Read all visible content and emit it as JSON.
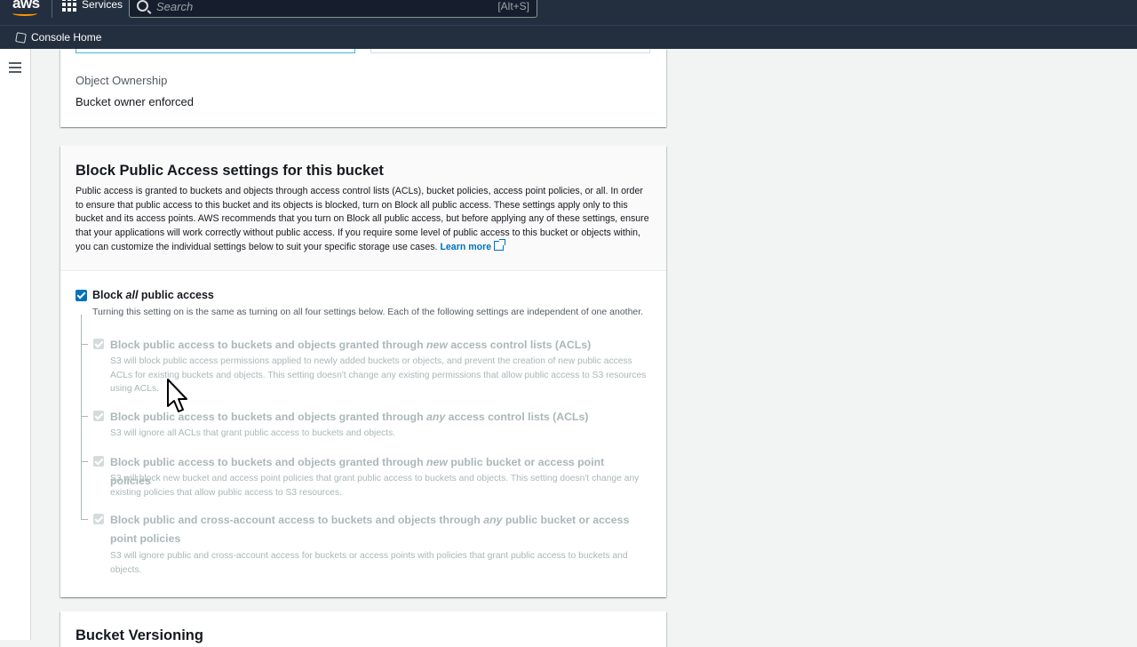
{
  "topnav": {
    "logo_text": "aws",
    "services_label": "Services",
    "search_placeholder": "Search",
    "search_shortcut": "[Alt+S]"
  },
  "subnav": {
    "console_home": "Console Home"
  },
  "ownership": {
    "label": "Object Ownership",
    "value": "Bucket owner enforced"
  },
  "block_public_access": {
    "title": "Block Public Access settings for this bucket",
    "description": "Public access is granted to buckets and objects through access control lists (ACLs), bucket policies, access point policies, or all. In order to ensure that public access to this bucket and its objects is blocked, turn on Block all public access. These settings apply only to this bucket and its access points. AWS recommends that you turn on Block all public access, but before applying any of these settings, ensure that your applications will work correctly without public access. If you require some level of public access to this bucket or objects within, you can customize the individual settings below to suit your specific storage use cases.",
    "learn_more": "Learn more",
    "main_checkbox": {
      "label_prefix": "Block ",
      "label_em": "all",
      "label_suffix": " public access",
      "checked": true,
      "description": "Turning this setting on is the same as turning on all four settings below. Each of the following settings are independent of one another."
    },
    "settings": [
      {
        "title_prefix": "Block public access to buckets and objects granted through ",
        "title_em": "new",
        "title_suffix": " access control lists (ACLs)",
        "description": "S3 will block public access permissions applied to newly added buckets or objects, and prevent the creation of new public access ACLs for existing buckets and objects. This setting doesn't change any existing permissions that allow public access to S3 resources using ACLs.",
        "checked": true
      },
      {
        "title_prefix": "Block public access to buckets and objects granted through ",
        "title_em": "any",
        "title_suffix": " access control lists (ACLs)",
        "description": "S3 will ignore all ACLs that grant public access to buckets and objects.",
        "checked": true
      },
      {
        "title_prefix": "Block public access to buckets and objects granted through ",
        "title_em": "new",
        "title_suffix": " public bucket or access point policies",
        "description": "S3 will block new bucket and access point policies that grant public access to buckets and objects. This setting doesn't change any existing policies that allow public access to S3 resources.",
        "checked": true
      },
      {
        "title_prefix": "Block public and cross-account access to buckets and objects through ",
        "title_em": "any",
        "title_suffix": " public bucket or access point policies",
        "description": "S3 will ignore public and cross-account access for buckets or access points with policies that grant public access to buckets and objects.",
        "checked": true
      }
    ]
  },
  "versioning": {
    "title": "Bucket Versioning"
  },
  "colors": {
    "nav_bg": "#232f3e",
    "accent": "#0073bb",
    "aws_orange": "#ff9900",
    "disabled_text": "#aab7b8"
  }
}
